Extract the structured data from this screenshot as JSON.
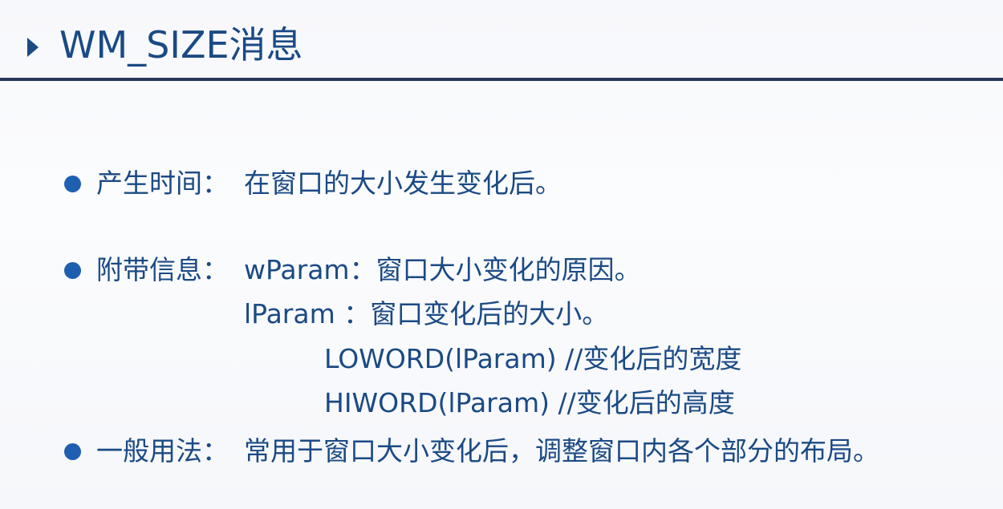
{
  "title": "WM_SIZE消息",
  "items": [
    {
      "label": "产生时间：",
      "text": "在窗口的大小发生变化后。"
    },
    {
      "label": "附带信息：",
      "lines": [
        "wParam：窗口大小变化的原因。",
        "lParam  ：窗口变化后的大小。",
        "LOWORD(lParam) //变化后的宽度",
        "HIWORD(lParam) //变化后的高度"
      ]
    },
    {
      "label": "一般用法：",
      "text": "常用于窗口大小变化后，调整窗口内各个部分的布局。"
    }
  ],
  "colors": {
    "title": "#1b4a84",
    "bullet": "#1f5fb0",
    "rule": "#25375a"
  }
}
